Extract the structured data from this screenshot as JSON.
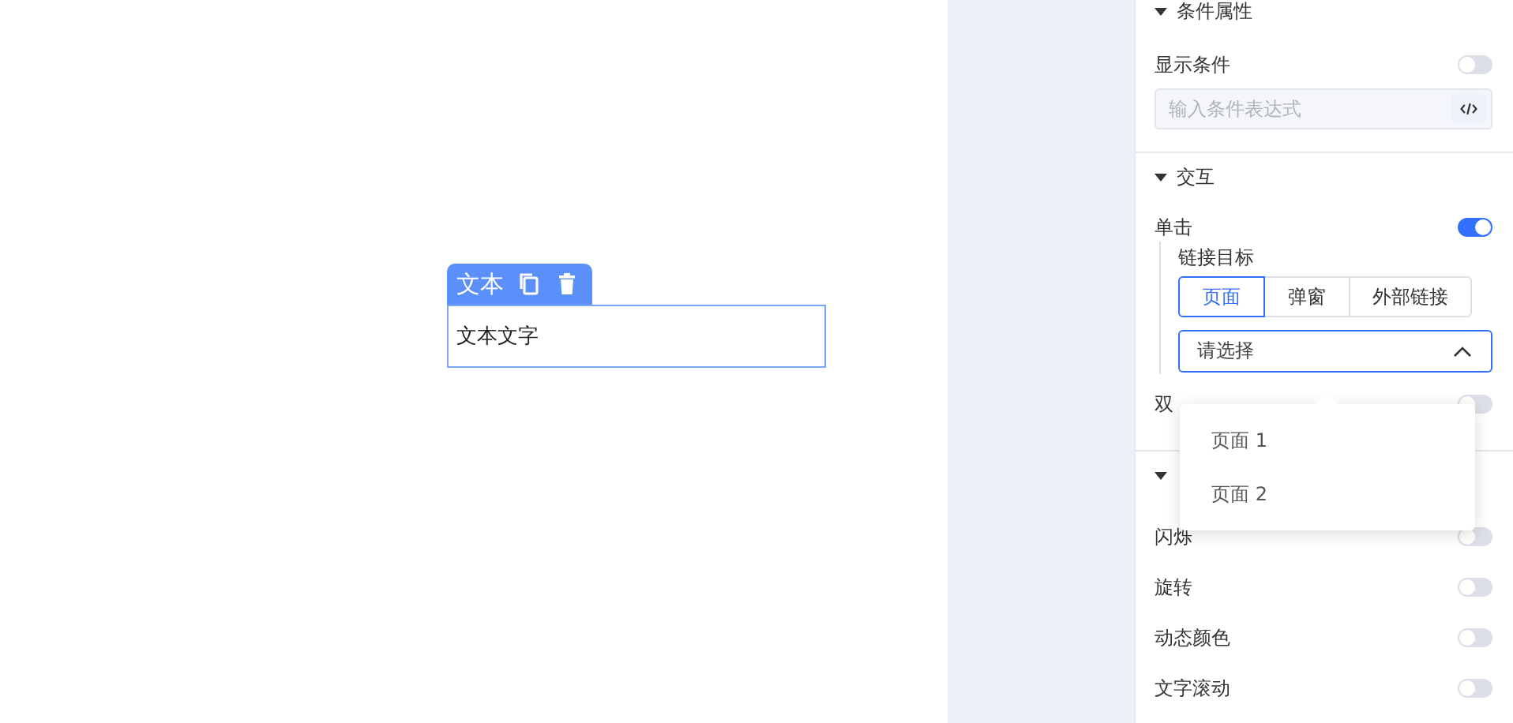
{
  "canvas": {
    "element": {
      "label": "文本",
      "content": "文本文字"
    }
  },
  "condition": {
    "title": "条件属性",
    "expanded": true,
    "toggle": {
      "label": "显示条件",
      "on": false
    },
    "expression": {
      "placeholder": "输入条件表达式"
    }
  },
  "interaction": {
    "title": "交互",
    "expanded": true,
    "click": {
      "label": "单击",
      "on": true
    },
    "link_target": {
      "label": "链接目标",
      "options": [
        {
          "label": "页面",
          "selected": true
        },
        {
          "label": "弹窗",
          "selected": false
        },
        {
          "label": "外部链接",
          "selected": false
        }
      ],
      "select": {
        "placeholder": "请选择",
        "open": true,
        "options": [
          "页面 1",
          "页面 2"
        ]
      }
    },
    "double_click": {
      "label": "双",
      "on": false
    }
  },
  "animation": {
    "expanded": true,
    "items": [
      {
        "label": "闪烁",
        "on": false
      },
      {
        "label": "旋转",
        "on": false
      },
      {
        "label": "动态颜色",
        "on": false
      },
      {
        "label": "文字滚动",
        "on": false
      }
    ]
  }
}
